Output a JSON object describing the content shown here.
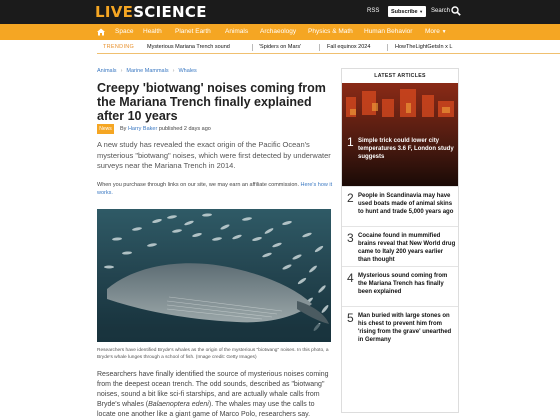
{
  "header": {
    "logo_live": "LIVE",
    "logo_science": "SCIENCE",
    "rss": "RSS",
    "subscribe": "Subscribe",
    "search": "Search"
  },
  "nav": [
    "Space",
    "Health",
    "Planet Earth",
    "Animals",
    "Archaeology",
    "Physics & Math",
    "Human Behavior",
    "More"
  ],
  "trending": {
    "label": "TRENDING",
    "items": [
      "Mysterious Mariana Trench sound",
      "'Spiders on Mars'",
      "Fall equinox 2024",
      "HowTheLightGetsIn x L"
    ]
  },
  "breadcrumb": [
    "Animals",
    "Marine Mammals",
    "Whales"
  ],
  "article": {
    "title": "Creepy 'biotwang' noises coming from the Mariana Trench finally explained after 10 years",
    "tag": "News",
    "byline_prefix": "By",
    "author": "Harry Baker",
    "published": "published 2 days ago",
    "summary": "A new study has revealed the exact origin of the Pacific Ocean's mysterious \"biotwang\" noises, which were first detected by underwater surveys near the Mariana Trench in 2014.",
    "affiliate": "When you purchase through links on our site, we may earn an affiliate commission.",
    "affiliate_link": "Here's how it works.",
    "caption": "Researchers have identified Bryde's whales as the origin of the mysterious \"biotwang\" noises. In this photo, a Bryde's whale lunges through a school of fish. (Image credit: Getty Images)",
    "body_1": "Researchers have finally identified the source of mysterious noises coming from the deepest ocean trench. The odd sounds, described as \"biotwang\" noises, sound a bit like sci-fi starships, and are actually whale calls from Bryde's whales (",
    "body_species": "Balaenoptera edeni",
    "body_2": "). The whales may use the calls to locate one another like a giant game of Marco Polo, researchers say."
  },
  "sidebar": {
    "heading": "LATEST ARTICLES",
    "items": [
      {
        "num": "1",
        "title": "Simple trick could lower city temperatures 3.6 F, London study suggests"
      },
      {
        "num": "2",
        "title": "People in Scandinavia may have used boats made of animal skins to hunt and trade 5,000 years ago"
      },
      {
        "num": "3",
        "title": "Cocaine found in mummified brains reveal that New World drug came to Italy 200 years earlier than thought"
      },
      {
        "num": "4",
        "title": "Mysterious sound coming from the Mariana Trench has finally been explained"
      },
      {
        "num": "5",
        "title": "Man buried with large stones on his chest to prevent him from 'rising from the grave' unearthed in Germany"
      }
    ]
  },
  "colors": {
    "brand": "#f5a623",
    "header_bg": "#1b1b1b",
    "link": "#3a78c2"
  }
}
